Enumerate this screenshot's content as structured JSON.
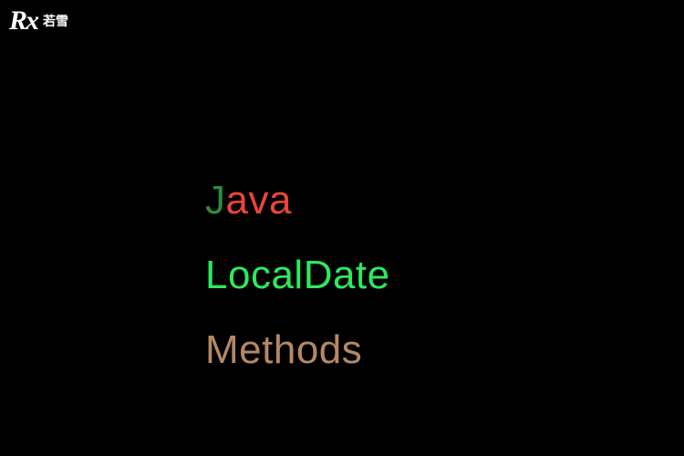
{
  "logo": {
    "symbol": "Rx",
    "text": "若雪"
  },
  "content": {
    "line1_first": "J",
    "line1_rest": "ava",
    "line2": "LocalDate",
    "line3": "Methods"
  }
}
